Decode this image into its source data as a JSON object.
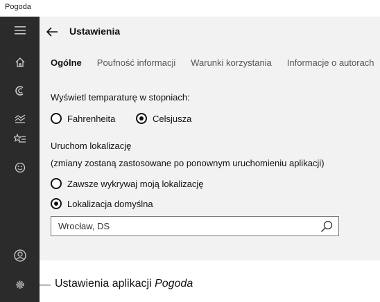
{
  "app": {
    "title": "Pogoda"
  },
  "sidebar": {
    "items": [
      {
        "icon": "hamburger-icon"
      },
      {
        "icon": "home-icon"
      },
      {
        "icon": "forecast-icon"
      },
      {
        "icon": "historical-weather-icon"
      },
      {
        "icon": "favorites-icon"
      },
      {
        "icon": "feedback-smiley-icon"
      },
      {
        "icon": "account-icon"
      },
      {
        "icon": "gear-icon"
      }
    ]
  },
  "header": {
    "title": "Ustawienia"
  },
  "tabs": [
    {
      "label": "Ogólne",
      "active": true
    },
    {
      "label": "Poufność informacji",
      "active": false
    },
    {
      "label": "Warunki korzystania",
      "active": false
    },
    {
      "label": "Informacje o autorach",
      "active": false
    }
  ],
  "temperature": {
    "label": "Wyświetl temparaturę w stopniach:",
    "options": [
      {
        "label": "Fahrenheita",
        "checked": false
      },
      {
        "label": "Celsjusza",
        "checked": true
      }
    ]
  },
  "location": {
    "label": "Uruchom lokalizację",
    "note": "(zmiany zostaną zastosowane po ponownym uruchomieniu aplikacji)",
    "options": [
      {
        "label": "Zawsze wykrywaj moją lokalizację",
        "checked": false
      },
      {
        "label": "Lokalizacja domyślna",
        "checked": true
      }
    ],
    "search_value": "Wrocław, DS"
  },
  "caption": {
    "text": "Ustawienia aplikacji ",
    "italic": "Pogoda"
  }
}
